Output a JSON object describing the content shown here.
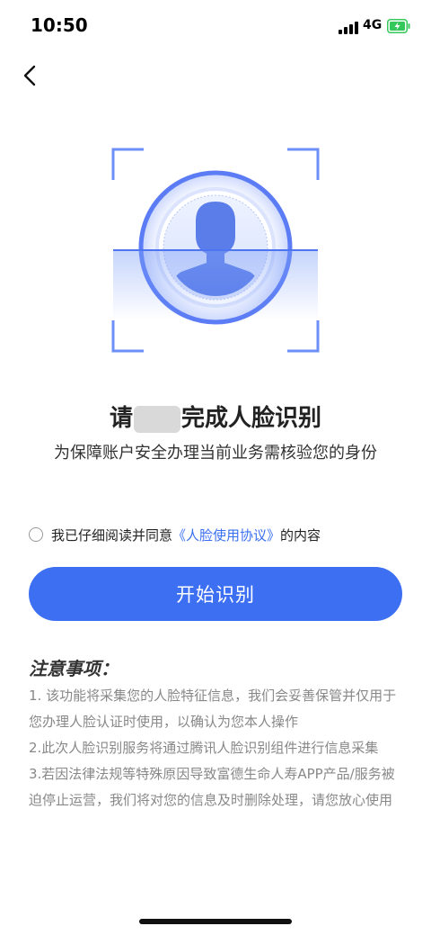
{
  "status_bar": {
    "time": "10:50",
    "network": "4G",
    "signal_icon": "signal-bars-icon",
    "battery_icon": "battery-charging-icon",
    "battery_color": "#34c759"
  },
  "nav": {
    "back_icon": "chevron-left-icon"
  },
  "face_graphic": {
    "icon": "face-scan-icon",
    "accent": "#5b7cf5"
  },
  "title": {
    "prefix": "请",
    "suffix": "完成人脸识别"
  },
  "subtitle": "为保障账户安全办理当前业务需核验您的身份",
  "agreement": {
    "text_before": "我已仔细阅读并同意",
    "link": "《人脸使用协议》",
    "text_after": "的内容",
    "checked": false
  },
  "start_button": {
    "label": "开始识别",
    "color": "#3d6ff3"
  },
  "notice": {
    "title": "注意事项：",
    "items": [
      "1. 该功能将采集您的人脸特征信息，我们会妥善保管并仅用于您办理人脸认证时使用，以确认为您本人操作",
      "2.此次人脸识别服务将通过腾讯人脸识别组件进行信息采集",
      "3.若因法律法规等特殊原因导致富德生命人寿APP产品/服务被迫停止运营，我们将对您的信息及时删除处理，请您放心使用"
    ]
  }
}
